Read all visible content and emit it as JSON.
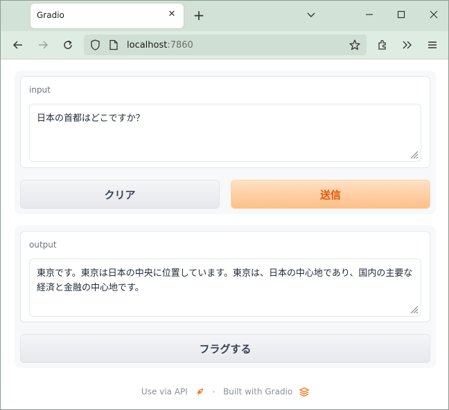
{
  "browser": {
    "tab_title": "Gradio",
    "url_host": "localhost",
    "url_port": ":7860"
  },
  "form": {
    "input_label": "input",
    "input_value": "日本の首都はどこですか？",
    "clear_label": "クリア",
    "submit_label": "送信",
    "output_label": "output",
    "output_value": "東京です。東京は日本の中央に位置しています。東京は、日本の中心地であり、国内の主要な経済と金融の中心地です。",
    "flag_label": "フラグする"
  },
  "footer": {
    "api_label": "Use via API",
    "separator": "·",
    "built_label": "Built with Gradio"
  },
  "colors": {
    "accent": "#ea580c",
    "primary_bg": "#fdbf87",
    "browser_chrome": "#dfece2"
  }
}
